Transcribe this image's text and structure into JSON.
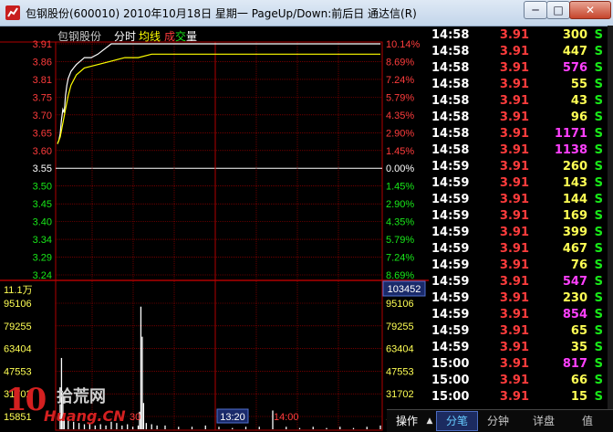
{
  "window": {
    "title": "包钢股份(600010) 2010年10月18日 星期一 PageUp/Down:前后日 通达信(R)",
    "min_label": "─",
    "max_label": "□",
    "close_label": "✕"
  },
  "chart_header": {
    "stock_name": "包钢股份",
    "mode": "分时",
    "avg_label": "均线",
    "cheng": "成",
    "jiao": "交",
    "liang": "量"
  },
  "price_axis": {
    "labels": [
      "3.91",
      "3.86",
      "3.81",
      "3.75",
      "3.70",
      "3.65",
      "3.60",
      "3.55",
      "3.50",
      "3.45",
      "3.40",
      "3.34",
      "3.29",
      "3.24"
    ],
    "pct_labels": [
      "10.14%",
      "8.69%",
      "7.24%",
      "5.79%",
      "4.35%",
      "2.90%",
      "1.45%",
      "0.00%",
      "1.45%",
      "2.90%",
      "4.35%",
      "5.79%",
      "7.24%",
      "8.69%"
    ]
  },
  "volume_axis": {
    "unit_label": "11.1万",
    "left_labels": [
      "95106",
      "79255",
      "63404",
      "47553",
      "31702",
      "15851"
    ],
    "right_top": "103452",
    "right_labels": [
      "95106",
      "79255",
      "63404",
      "47553",
      "31702",
      "15851"
    ]
  },
  "time_axis": {
    "labels": [
      "30",
      "13:20",
      "14:00"
    ],
    "highlight": "13:20"
  },
  "colors": {
    "grid_red": "#b00000",
    "price_line": "#ffffff",
    "avg_line": "#ffff00",
    "up_text": "#ff3c3c",
    "down_text": "#19e819",
    "volume_text": "#ffff54",
    "big_volume": "#ff40ff"
  },
  "chart_data": {
    "type": "line",
    "title": "包钢股份",
    "prev_close": 3.55,
    "ylim": [
      3.2,
      3.91
    ],
    "series": [
      {
        "name": "分时",
        "x": [
          0,
          1,
          2,
          3,
          4,
          5,
          6,
          7,
          8,
          9,
          10,
          12,
          14,
          17,
          20,
          25,
          30,
          40,
          50,
          60,
          70,
          80,
          100,
          120,
          160,
          200,
          240
        ],
        "values": [
          3.62,
          3.63,
          3.65,
          3.69,
          3.72,
          3.71,
          3.76,
          3.79,
          3.81,
          3.82,
          3.83,
          3.84,
          3.85,
          3.86,
          3.87,
          3.87,
          3.88,
          3.91,
          3.91,
          3.91,
          3.91,
          3.91,
          3.91,
          3.91,
          3.91,
          3.91,
          3.91
        ]
      },
      {
        "name": "均线",
        "x": [
          0,
          2,
          4,
          6,
          8,
          10,
          14,
          20,
          30,
          40,
          50,
          60,
          70,
          80,
          100,
          120,
          160,
          200,
          240
        ],
        "values": [
          3.62,
          3.64,
          3.68,
          3.72,
          3.76,
          3.79,
          3.82,
          3.84,
          3.85,
          3.86,
          3.87,
          3.87,
          3.88,
          3.88,
          3.88,
          3.88,
          3.88,
          3.88,
          3.88
        ]
      }
    ],
    "volume": {
      "ylim": [
        0,
        111000
      ],
      "x": [
        2,
        3,
        4,
        5,
        8,
        12,
        16,
        20,
        24,
        28,
        32,
        36,
        40,
        44,
        48,
        52,
        56,
        60,
        61,
        62,
        63,
        64,
        66,
        70,
        74,
        80,
        90,
        100,
        110,
        120,
        130,
        140,
        150,
        160,
        170,
        180,
        190,
        200,
        210,
        220,
        230,
        240
      ],
      "values": [
        20000,
        57000,
        28000,
        12000,
        9000,
        6000,
        5000,
        4000,
        5000,
        3000,
        4000,
        3000,
        6000,
        5000,
        3000,
        4000,
        2000,
        3000,
        14000,
        98000,
        74000,
        21000,
        5000,
        4000,
        3000,
        3000,
        2000,
        2000,
        3000,
        2000,
        1000,
        2000,
        2000,
        15000,
        2000,
        1000,
        2000,
        1000,
        2000,
        1000,
        2000,
        3000
      ]
    }
  },
  "ticks": [
    {
      "time": "14:58",
      "price": "3.91",
      "vol": "300",
      "side": "S"
    },
    {
      "time": "14:58",
      "price": "3.91",
      "vol": "447",
      "side": "S"
    },
    {
      "time": "14:58",
      "price": "3.91",
      "vol": "576",
      "side": "S"
    },
    {
      "time": "14:58",
      "price": "3.91",
      "vol": "55",
      "side": "S"
    },
    {
      "time": "14:58",
      "price": "3.91",
      "vol": "43",
      "side": "S"
    },
    {
      "time": "14:58",
      "price": "3.91",
      "vol": "96",
      "side": "S"
    },
    {
      "time": "14:58",
      "price": "3.91",
      "vol": "1171",
      "side": "S"
    },
    {
      "time": "14:58",
      "price": "3.91",
      "vol": "1138",
      "side": "S"
    },
    {
      "time": "14:59",
      "price": "3.91",
      "vol": "260",
      "side": "S"
    },
    {
      "time": "14:59",
      "price": "3.91",
      "vol": "143",
      "side": "S"
    },
    {
      "time": "14:59",
      "price": "3.91",
      "vol": "144",
      "side": "S"
    },
    {
      "time": "14:59",
      "price": "3.91",
      "vol": "169",
      "side": "S"
    },
    {
      "time": "14:59",
      "price": "3.91",
      "vol": "399",
      "side": "S"
    },
    {
      "time": "14:59",
      "price": "3.91",
      "vol": "467",
      "side": "S"
    },
    {
      "time": "14:59",
      "price": "3.91",
      "vol": "76",
      "side": "S"
    },
    {
      "time": "14:59",
      "price": "3.91",
      "vol": "547",
      "side": "S"
    },
    {
      "time": "14:59",
      "price": "3.91",
      "vol": "230",
      "side": "S"
    },
    {
      "time": "14:59",
      "price": "3.91",
      "vol": "854",
      "side": "S"
    },
    {
      "time": "14:59",
      "price": "3.91",
      "vol": "65",
      "side": "S"
    },
    {
      "time": "14:59",
      "price": "3.91",
      "vol": "35",
      "side": "S"
    },
    {
      "time": "15:00",
      "price": "3.91",
      "vol": "817",
      "side": "S"
    },
    {
      "time": "15:00",
      "price": "3.91",
      "vol": "66",
      "side": "S"
    },
    {
      "time": "15:00",
      "price": "3.91",
      "vol": "15",
      "side": "S"
    }
  ],
  "bottom_tabs": {
    "ops": "操作",
    "ops_arrow": "▲",
    "trades": "分笔",
    "minute": "分钟",
    "detail": "详盘",
    "value": "值"
  },
  "watermark": {
    "num": "10",
    "cn": "拾荒网",
    "en": "Huang.CN"
  }
}
